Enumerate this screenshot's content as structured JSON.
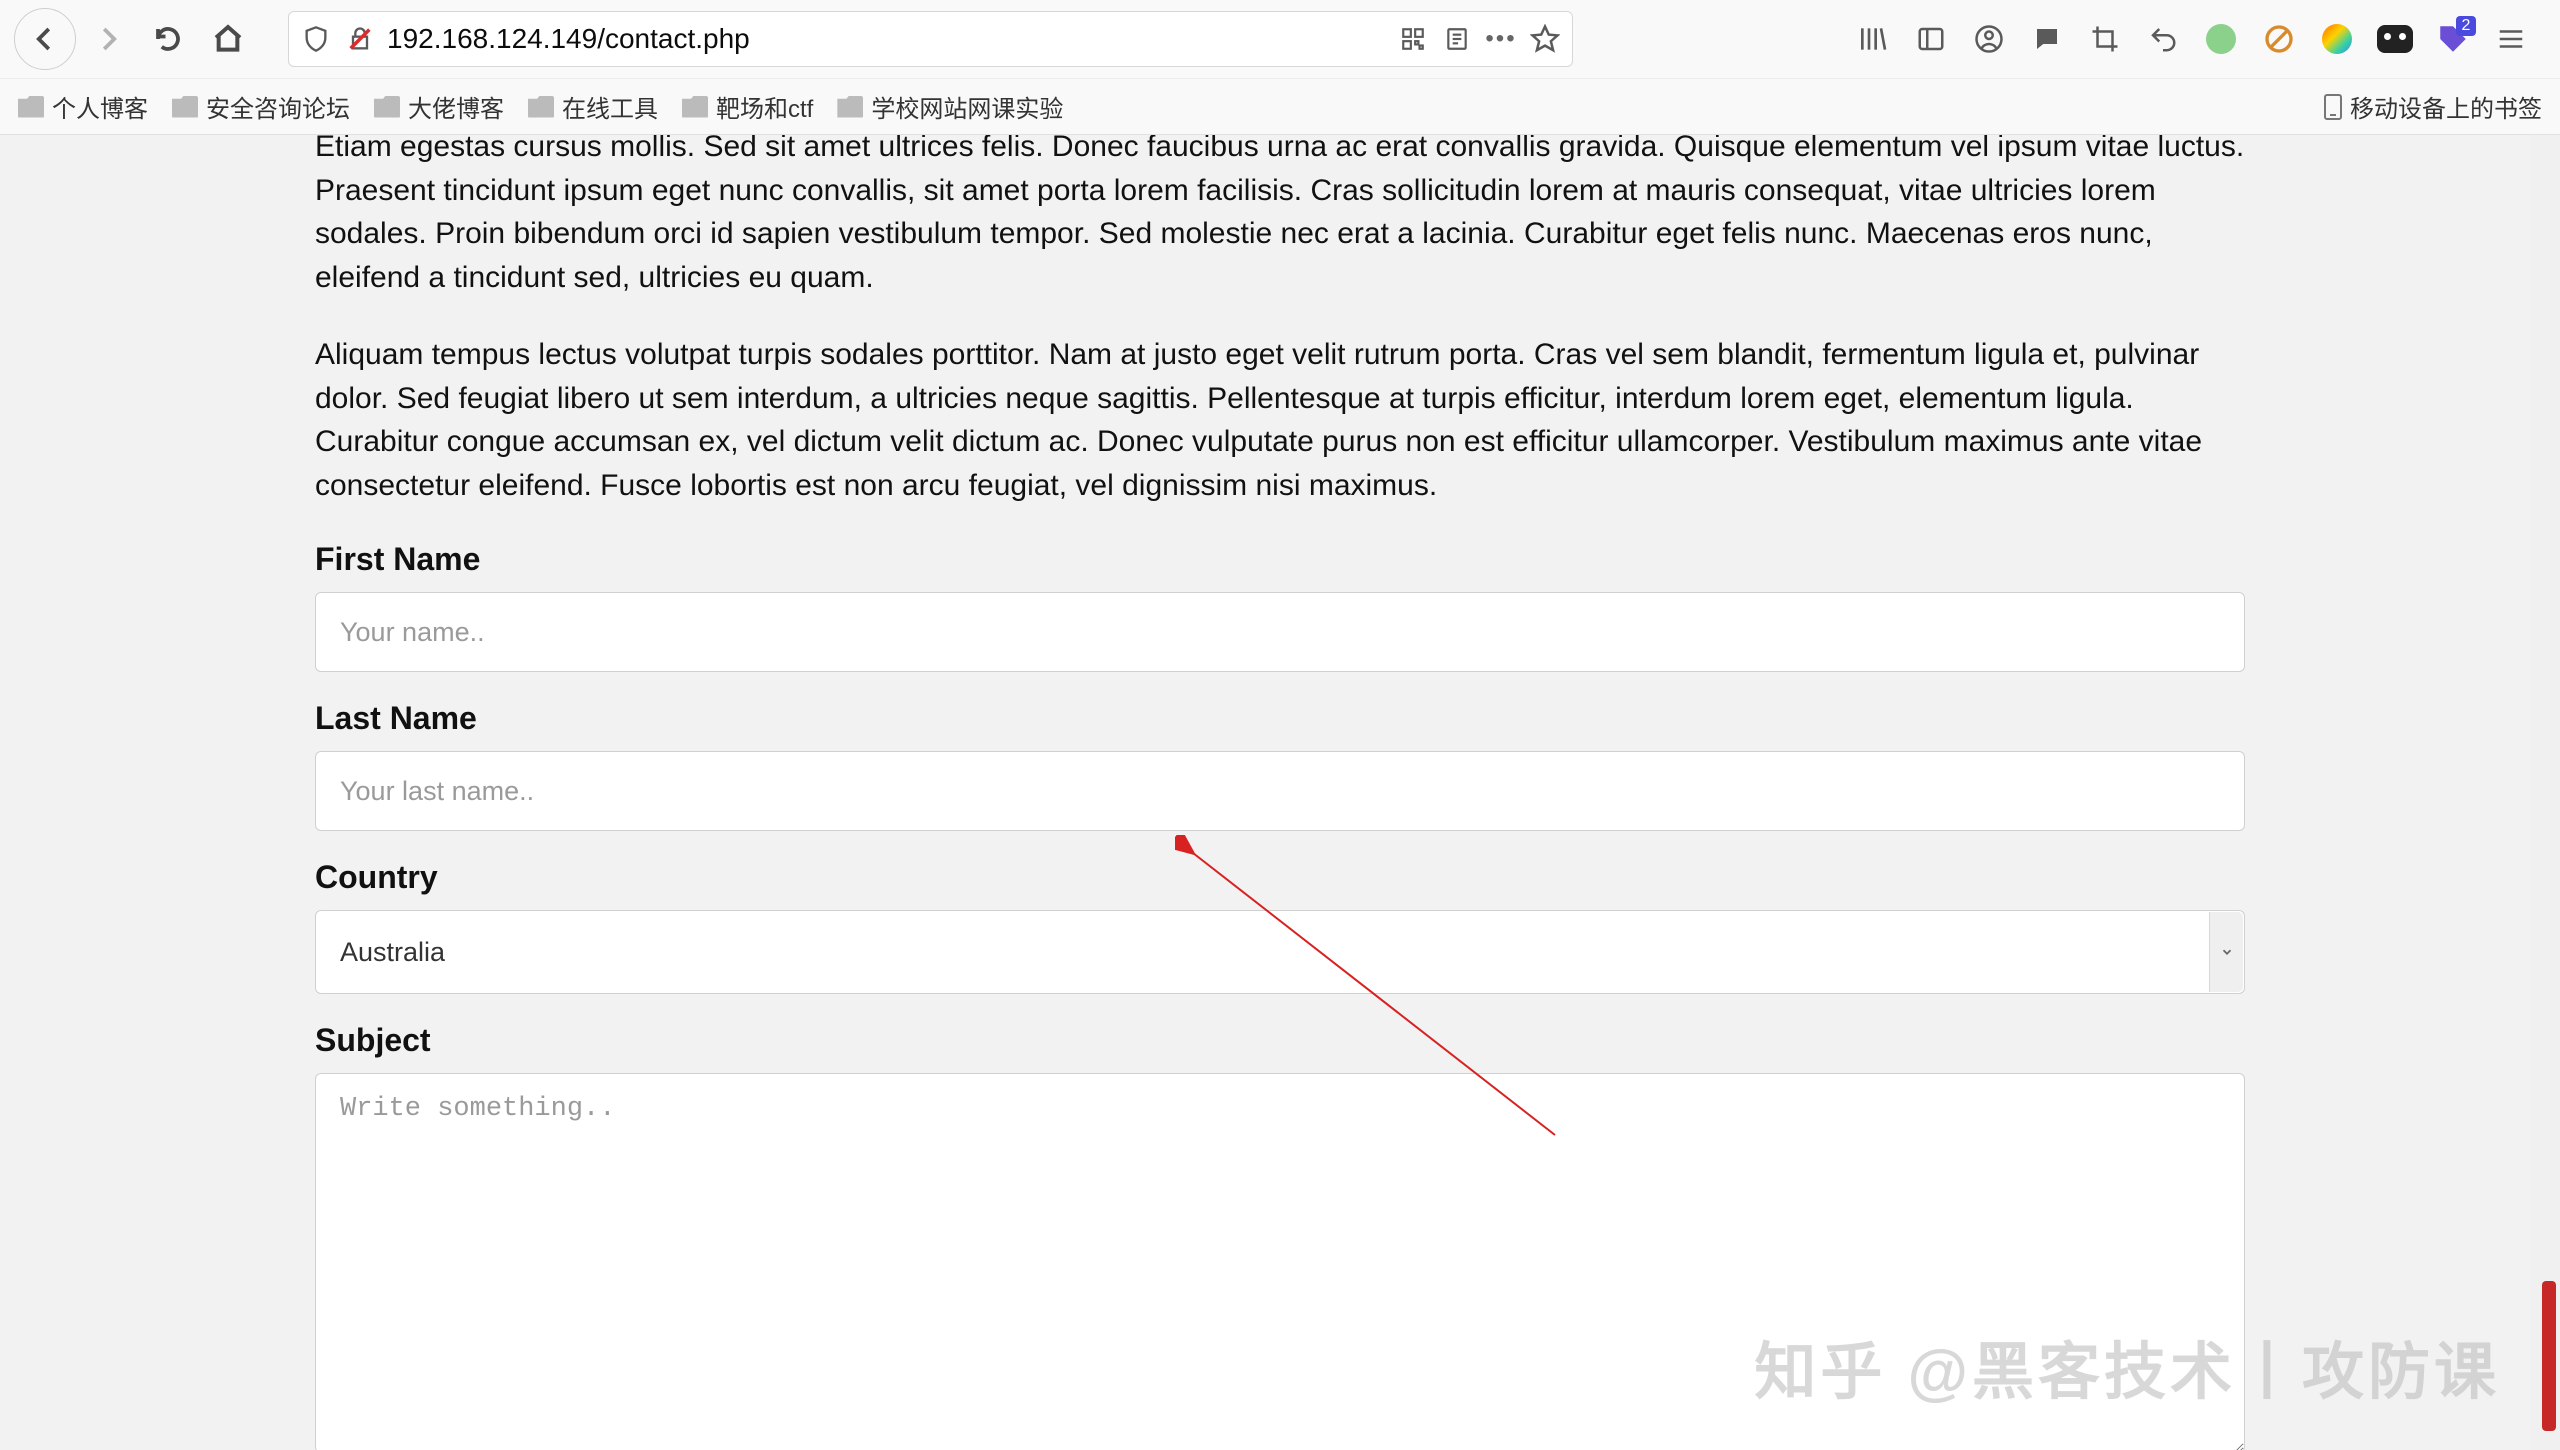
{
  "browser": {
    "url": "192.168.124.149/contact.php",
    "ext_badge": "2"
  },
  "bookmarks": {
    "items": [
      "个人博客",
      "安全咨询论坛",
      "大佬博客",
      "在线工具",
      "靶场和ctf",
      "学校网站网课实验"
    ],
    "mobile": "移动设备上的书签"
  },
  "page": {
    "para1": "Etiam egestas cursus mollis. Sed sit amet ultrices felis. Donec faucibus urna ac erat convallis gravida. Quisque elementum vel ipsum vitae luctus. Praesent tincidunt ipsum eget nunc convallis, sit amet porta lorem facilisis. Cras sollicitudin lorem at mauris consequat, vitae ultricies lorem sodales. Proin bibendum orci id sapien vestibulum tempor. Sed molestie nec erat a lacinia. Curabitur eget felis nunc. Maecenas eros nunc, eleifend a tincidunt sed, ultricies eu quam.",
    "para2": "Aliquam tempus lectus volutpat turpis sodales porttitor. Nam at justo eget velit rutrum porta. Cras vel sem blandit, fermentum ligula et, pulvinar dolor. Sed feugiat libero ut sem interdum, a ultricies neque sagittis. Pellentesque at turpis efficitur, interdum lorem eget, elementum ligula. Curabitur congue accumsan ex, vel dictum velit dictum ac. Donec vulputate purus non est efficitur ullamcorper. Vestibulum maximus ante vitae consectetur eleifend. Fusce lobortis est non arcu feugiat, vel dignissim nisi maximus.",
    "labels": {
      "first_name": "First Name",
      "last_name": "Last Name",
      "country": "Country",
      "subject": "Subject"
    },
    "placeholders": {
      "first_name": "Your name..",
      "last_name": "Your last name..",
      "subject": "Write something.."
    },
    "country_selected": "Australia"
  },
  "watermark": "知乎 @黑客技术丨攻防课"
}
